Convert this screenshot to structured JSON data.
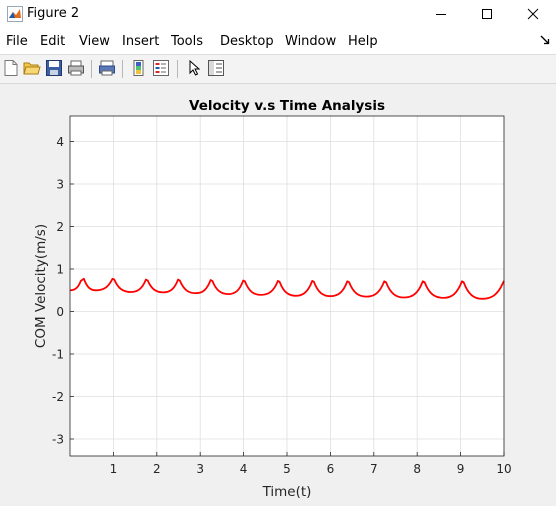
{
  "window": {
    "title": "Figure 2",
    "controls": [
      "minimize-icon",
      "maximize-icon",
      "close-icon"
    ]
  },
  "menu": {
    "items": [
      "File",
      "Edit",
      "View",
      "Insert",
      "Tools",
      "Desktop",
      "Window",
      "Help"
    ]
  },
  "toolbar": {
    "buttons": [
      "new-figure-icon",
      "open-file-icon",
      "save-icon",
      "print-icon",
      "print-preview-icon",
      "insert-colorbar-icon",
      "insert-legend-icon",
      "edit-plot-arrow-icon",
      "property-editor-icon"
    ]
  },
  "chart_data": {
    "type": "line",
    "title": "Velocity v.s Time Analysis",
    "xlabel": "Time(t)",
    "ylabel": "COM Velocity(m/s)",
    "xlim": [
      0,
      10
    ],
    "ylim": [
      -3.4,
      4.6
    ],
    "xticks": [
      1,
      2,
      3,
      4,
      5,
      6,
      7,
      8,
      9,
      10
    ],
    "yticks": [
      -3,
      -2,
      -1,
      0,
      1,
      2,
      3,
      4
    ],
    "grid": true,
    "series": [
      {
        "color": "#ff0000",
        "x": [
          0,
          0.25,
          0.32,
          0.6,
          0.98,
          1.02,
          1.4,
          1.75,
          1.79,
          2.15,
          2.49,
          2.53,
          2.9,
          3.24,
          3.28,
          3.65,
          3.99,
          4.03,
          4.4,
          4.79,
          4.83,
          5.2,
          5.58,
          5.62,
          6.0,
          6.39,
          6.43,
          6.83,
          7.24,
          7.28,
          7.7,
          8.13,
          8.17,
          8.6,
          9.03,
          9.07,
          9.5,
          9.97,
          10.0
        ],
        "y": [
          0.5,
          0.72,
          0.77,
          0.5,
          0.77,
          0.75,
          0.46,
          0.75,
          0.73,
          0.45,
          0.75,
          0.73,
          0.43,
          0.74,
          0.72,
          0.41,
          0.73,
          0.71,
          0.39,
          0.72,
          0.7,
          0.37,
          0.72,
          0.7,
          0.36,
          0.71,
          0.69,
          0.35,
          0.71,
          0.69,
          0.33,
          0.71,
          0.69,
          0.32,
          0.71,
          0.69,
          0.3,
          0.66,
          0.72
        ]
      }
    ]
  }
}
